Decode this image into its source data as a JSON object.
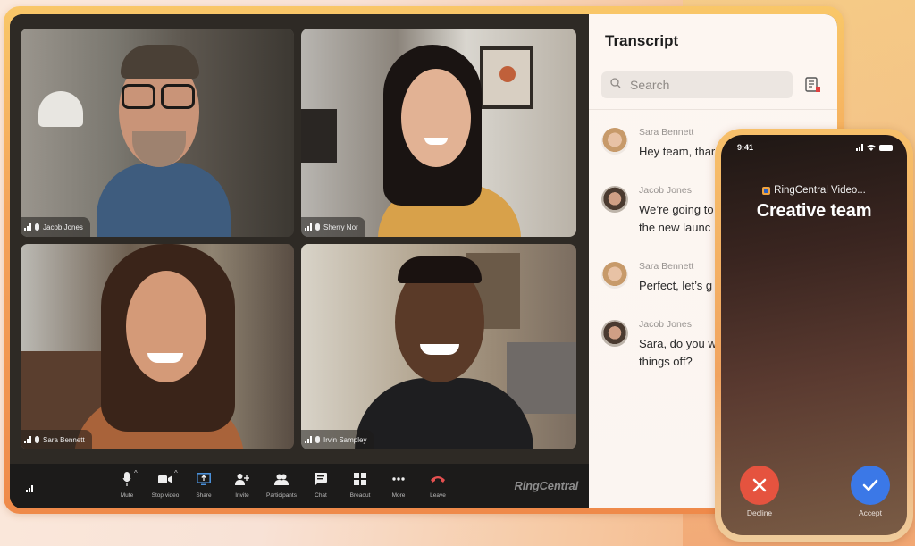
{
  "meeting": {
    "participants": [
      {
        "name": "Jacob Jones"
      },
      {
        "name": "Sherry Nor"
      },
      {
        "name": "Sara Bennett"
      },
      {
        "name": "Irvin Sampley"
      }
    ],
    "toolbar": {
      "buttons": [
        {
          "label": "Mute",
          "icon": "microphone-icon"
        },
        {
          "label": "Stop video",
          "icon": "video-camera-icon"
        },
        {
          "label": "Share",
          "icon": "share-screen-icon"
        },
        {
          "label": "Invite",
          "icon": "add-person-icon"
        },
        {
          "label": "Participants",
          "icon": "participants-icon"
        },
        {
          "label": "Chat",
          "icon": "chat-icon"
        },
        {
          "label": "Breaout",
          "icon": "breakout-grid-icon"
        },
        {
          "label": "More",
          "icon": "more-dots-icon"
        },
        {
          "label": "Leave",
          "icon": "hang-up-icon"
        }
      ],
      "brand": "RingCentral"
    }
  },
  "transcript": {
    "title": "Transcript",
    "search_placeholder": "Search",
    "messages": [
      {
        "speaker": "Sara Bennett",
        "text": "Hey team, thar"
      },
      {
        "speaker": "Jacob Jones",
        "text": "We’re going to the new launc"
      },
      {
        "speaker": "Sara Bennett",
        "text": "Perfect, let’s g"
      },
      {
        "speaker": "Jacob Jones",
        "text": "Sara, do you w things off?"
      }
    ]
  },
  "phone": {
    "time": "9:41",
    "app_name": "RingCentral Video...",
    "call_title": "Creative team",
    "decline_label": "Decline",
    "accept_label": "Accept",
    "decline_color": "#e5533f",
    "accept_color": "#3b78e7"
  },
  "colors": {
    "share_accent": "#4a90d9",
    "leave_red": "#e55050"
  }
}
